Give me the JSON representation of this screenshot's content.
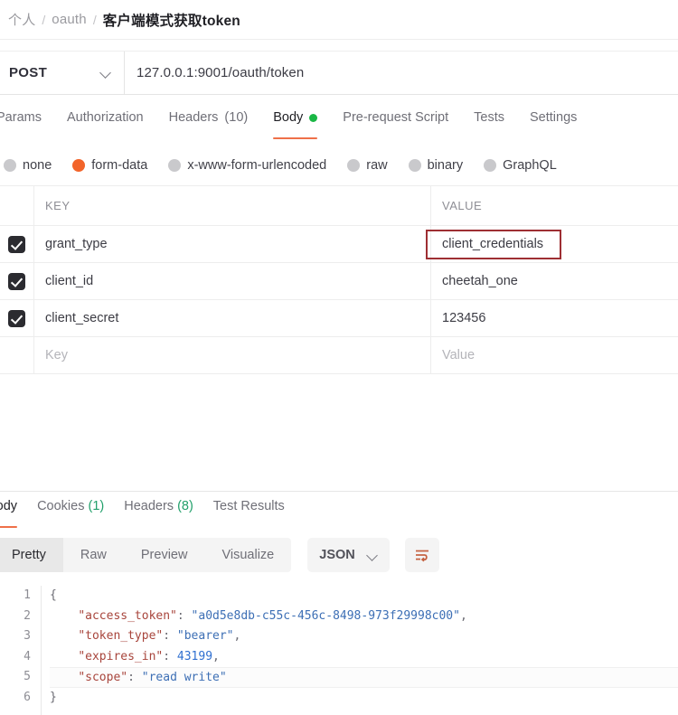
{
  "breadcrumb": {
    "workspace": "个人",
    "collection": "oauth",
    "request": "客户端模式获取token",
    "separator": "/"
  },
  "url_bar": {
    "method": "POST",
    "method_caret_icon": "chevron-down-icon",
    "url": "127.0.0.1:9001/oauth/token"
  },
  "request_tabs": [
    {
      "label": "Params",
      "active": false
    },
    {
      "label": "Authorization",
      "active": false
    },
    {
      "label": "Headers",
      "count": "(10)",
      "active": false
    },
    {
      "label": "Body",
      "active": true,
      "indicator": "green-dot"
    },
    {
      "label": "Pre-request Script",
      "active": false
    },
    {
      "label": "Tests",
      "active": false
    },
    {
      "label": "Settings",
      "active": false
    }
  ],
  "body_types": [
    {
      "label": "none",
      "selected": false
    },
    {
      "label": "form-data",
      "selected": true
    },
    {
      "label": "x-www-form-urlencoded",
      "selected": false
    },
    {
      "label": "raw",
      "selected": false
    },
    {
      "label": "binary",
      "selected": false
    },
    {
      "label": "GraphQL",
      "selected": false
    }
  ],
  "kv_table": {
    "headers": {
      "key": "KEY",
      "value": "VALUE"
    },
    "rows": [
      {
        "checked": true,
        "key": "grant_type",
        "value": "client_credentials",
        "highlighted": true
      },
      {
        "checked": true,
        "key": "client_id",
        "value": "cheetah_one",
        "highlighted": false
      },
      {
        "checked": true,
        "key": "client_secret",
        "value": "123456",
        "highlighted": false
      }
    ],
    "placeholder_row": {
      "key": "Key",
      "value": "Value"
    }
  },
  "response_tabs": [
    {
      "label": "Body",
      "active": true
    },
    {
      "label": "Cookies",
      "count": "(1)",
      "active": false
    },
    {
      "label": "Headers",
      "count": "(8)",
      "active": false
    },
    {
      "label": "Test Results",
      "active": false
    }
  ],
  "format_bar": {
    "views": [
      {
        "label": "Pretty",
        "active": true
      },
      {
        "label": "Raw",
        "active": false
      },
      {
        "label": "Preview",
        "active": false
      },
      {
        "label": "Visualize",
        "active": false
      }
    ],
    "language": "JSON",
    "language_caret_icon": "chevron-down-icon",
    "wrap_icon": "word-wrap-icon"
  },
  "response_body": {
    "line_numbers": [
      "1",
      "2",
      "3",
      "4",
      "5",
      "6"
    ],
    "lines": [
      {
        "n": "1",
        "open": "{"
      },
      {
        "n": "2",
        "indent": "    ",
        "key": "\"access_token\"",
        "colon": ": ",
        "value": "\"a0d5e8db-c55c-456c-8498-973f29998c00\"",
        "comma": ",",
        "type": "string"
      },
      {
        "n": "3",
        "indent": "    ",
        "key": "\"token_type\"",
        "colon": ": ",
        "value": "\"bearer\"",
        "comma": ",",
        "type": "string"
      },
      {
        "n": "4",
        "indent": "    ",
        "key": "\"expires_in\"",
        "colon": ": ",
        "value": "43199",
        "comma": ",",
        "type": "number"
      },
      {
        "n": "5",
        "indent": "    ",
        "key": "\"scope\"",
        "colon": ": ",
        "value": "\"read write\"",
        "comma": "",
        "type": "string",
        "highlighted": true
      },
      {
        "n": "6",
        "close": "}"
      }
    ]
  },
  "colors": {
    "accent_orange": "#ef7049",
    "radio_selected": "#f2642a",
    "green_dot": "#1ab745",
    "count_green": "#22a06b",
    "highlight_box_red": "#9e2f33",
    "json_key": "#a8453c",
    "json_string": "#3d6fb5",
    "json_number": "#2f6fd0"
  }
}
